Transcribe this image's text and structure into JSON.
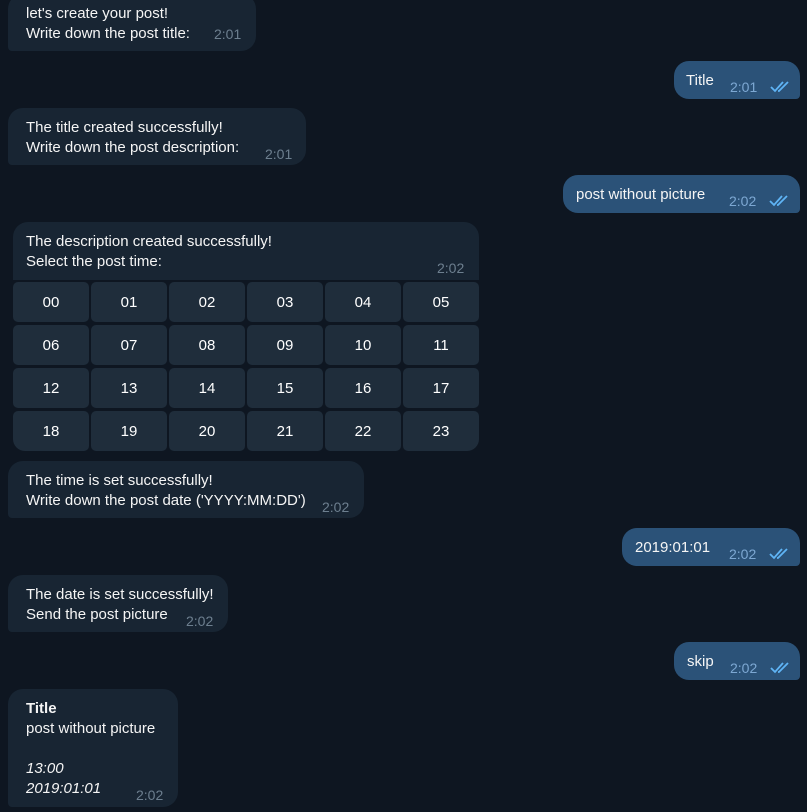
{
  "messages": [
    {
      "side": "in",
      "text": "let's create your post!\nWrite down the post title:",
      "time": "2:01"
    },
    {
      "side": "out",
      "text": "Title",
      "time": "2:01"
    },
    {
      "side": "in",
      "text": "The title created successfully!\nWrite down the post description:",
      "time": "2:01"
    },
    {
      "side": "out",
      "text": "post without picture",
      "time": "2:02"
    },
    {
      "side": "in",
      "text": "The description created successfully!\nSelect the post time:",
      "time": "2:02"
    },
    {
      "side": "in",
      "text": "The time is set successfully!\nWrite down the post date ('YYYY:MM:DD')",
      "time": "2:02"
    },
    {
      "side": "out",
      "text": "2019:01:01",
      "time": "2:02"
    },
    {
      "side": "in",
      "text": "The date is set successfully!\nSend the post picture",
      "time": "2:02"
    },
    {
      "side": "out",
      "text": "skip",
      "time": "2:02"
    }
  ],
  "final_post": {
    "title": "Title",
    "description": "post without picture",
    "time_value": "13:00",
    "date_value": "2019:01:01",
    "time": "2:02"
  },
  "time_keyboard": [
    "00",
    "01",
    "02",
    "03",
    "04",
    "05",
    "06",
    "07",
    "08",
    "09",
    "10",
    "11",
    "12",
    "13",
    "14",
    "15",
    "16",
    "17",
    "18",
    "19",
    "20",
    "21",
    "22",
    "23"
  ],
  "colors": {
    "background": "#0e1621",
    "incoming": "#182533",
    "outgoing": "#2b5278",
    "keyboard_button": "#1f2d3b",
    "read_check": "#5fb4f5"
  },
  "icons": {
    "read_status": "double-check-icon"
  }
}
